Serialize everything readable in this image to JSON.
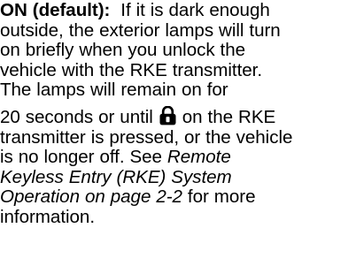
{
  "paragraph": {
    "label": "ON (default):",
    "line1_text": "  If it is dark enough",
    "line2": "outside, the exterior lamps will turn",
    "line3": "on briefly when you unlock the",
    "line4": "vehicle with the RKE transmitter.",
    "line5": "The lamps will remain on for",
    "line6_before_icon": "20 seconds or until ",
    "line6_after_icon": " on the RKE",
    "line7": "transmitter is pressed, or the vehicle",
    "line8_text": "is no longer off. See ",
    "line8_ref": "Remote",
    "line9_ref": "Keyless Entry (RKE) System",
    "line10_ref": "Operation on page 2-2",
    "line10_text": " for more",
    "line11": "information."
  },
  "icons": {
    "lock": "lock-icon"
  }
}
